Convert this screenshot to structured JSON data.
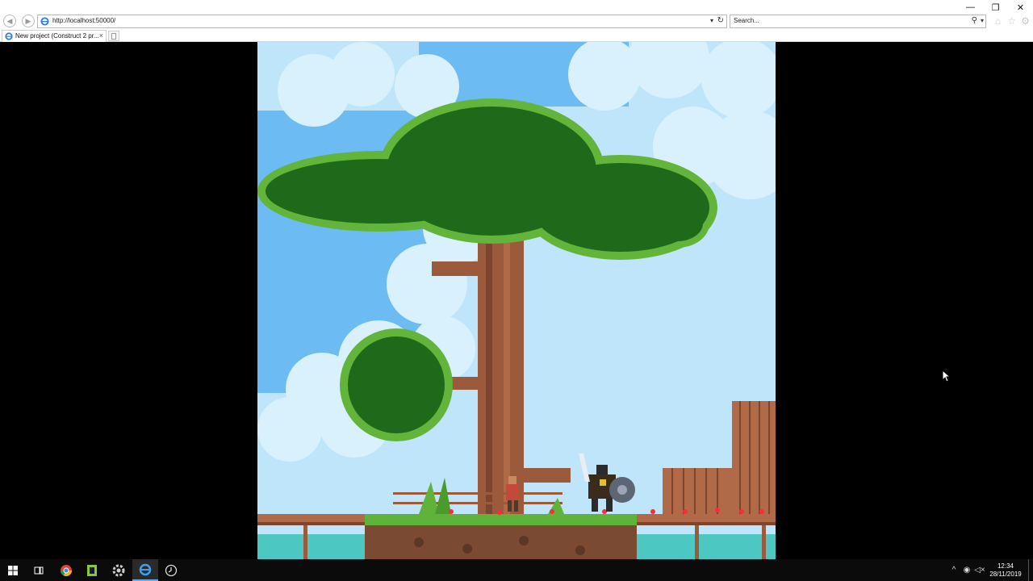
{
  "browser": {
    "url": "http://localhost:50000/",
    "search_placeholder": "Search...",
    "tab_title": "New project (Construct 2 pr...",
    "tab_close": "×",
    "window": {
      "minimize": "—",
      "restore": "❐",
      "close": "✕"
    },
    "icons": [
      "back-icon",
      "forward-icon",
      "ie-icon",
      "refresh-icon",
      "search-icon",
      "home-icon",
      "favorites-star-icon",
      "settings-gear-icon"
    ]
  },
  "game": {
    "scene": "pixel-art forest platformer",
    "colors": {
      "sky": "#bfe5fa",
      "sky_dark": "#6cbcf3",
      "leaves": "#1d6b1a",
      "leaves_light": "#62b53a",
      "trunk": "#9b5a3c",
      "water": "#4cc7c1",
      "dirt": "#7a4a33"
    }
  },
  "taskbar": {
    "apps": [
      "windows-start-icon",
      "task-view-icon",
      "chrome-icon",
      "notepad-plus-icon",
      "settings-gear-icon",
      "internet-explorer-icon",
      "clock-app-icon"
    ],
    "time": "12:34",
    "date": "28/11/2019"
  }
}
